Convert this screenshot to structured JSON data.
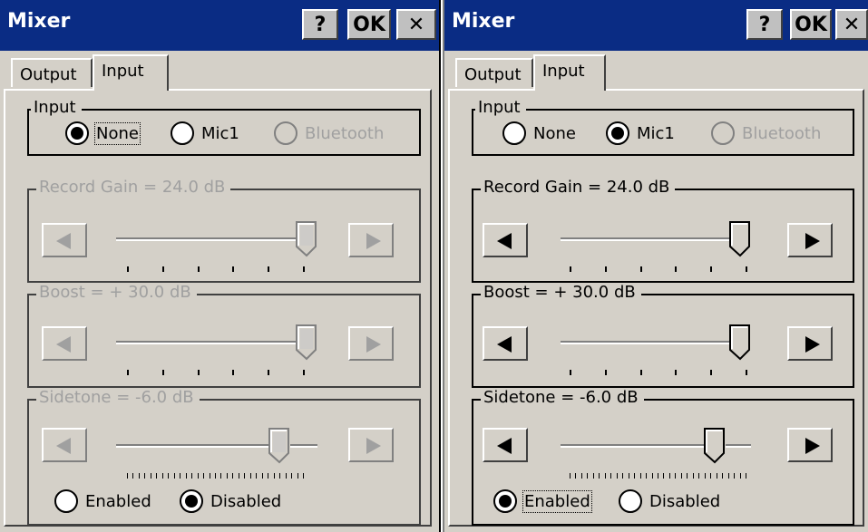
{
  "panels": [
    {
      "window_title": "Mixer",
      "buttons": {
        "help": "?",
        "ok": "OK",
        "close": "✕"
      },
      "tabs": [
        "Output",
        "Input"
      ],
      "active_tab": "Input",
      "input_group": {
        "label": "Input",
        "options": [
          "None",
          "Mic1",
          "Bluetooth"
        ],
        "selected": "None",
        "disabled_options": [
          "Bluetooth"
        ]
      },
      "record_gain": {
        "label": "Record Gain =  24.0 dB",
        "value_fraction": 1.0,
        "enabled": false
      },
      "boost": {
        "label": "Boost = + 30.0 dB",
        "value_fraction": 1.0,
        "enabled": false
      },
      "sidetone": {
        "label": "Sidetone =  -6.0 dB",
        "value_fraction": 0.85,
        "enabled": false
      },
      "sidetone_options": [
        "Enabled",
        "Disabled"
      ],
      "sidetone_selected": "Disabled"
    },
    {
      "window_title": "Mixer",
      "buttons": {
        "help": "?",
        "ok": "OK",
        "close": "✕"
      },
      "tabs": [
        "Output",
        "Input"
      ],
      "active_tab": "Input",
      "input_group": {
        "label": "Input",
        "options": [
          "None",
          "Mic1",
          "Bluetooth"
        ],
        "selected": "Mic1",
        "disabled_options": [
          "Bluetooth"
        ]
      },
      "record_gain": {
        "label": "Record Gain =  24.0 dB",
        "value_fraction": 1.0,
        "enabled": true
      },
      "boost": {
        "label": "Boost = + 30.0 dB",
        "value_fraction": 1.0,
        "enabled": true
      },
      "sidetone": {
        "label": "Sidetone =  -6.0 dB",
        "value_fraction": 0.85,
        "enabled": true
      },
      "sidetone_options": [
        "Enabled",
        "Disabled"
      ],
      "sidetone_selected": "Enabled"
    }
  ],
  "colors": {
    "titlebar": "#0a2c84",
    "face": "#d4d0c8",
    "disabled_text": "#a0a0a0"
  },
  "icons": {
    "left": "left-arrow-icon",
    "right": "right-arrow-icon"
  }
}
